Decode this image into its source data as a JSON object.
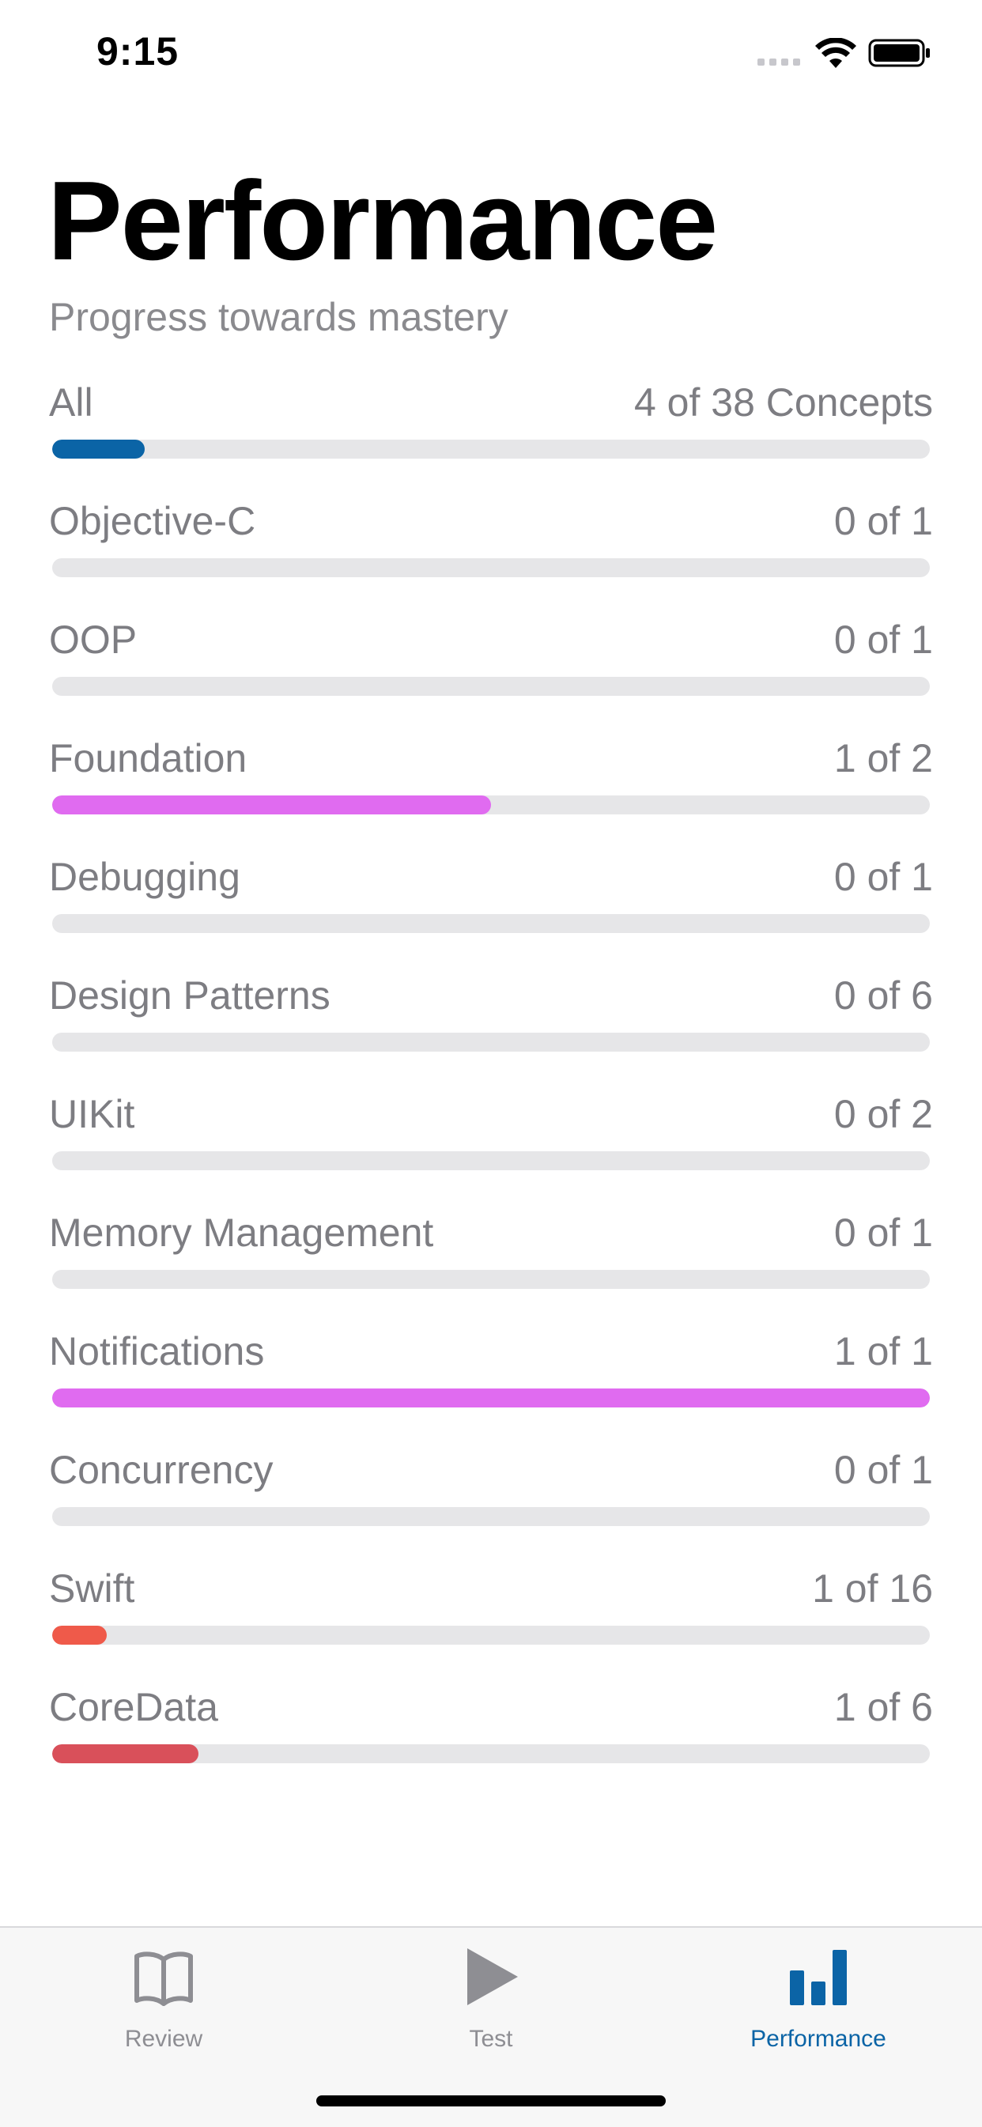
{
  "status_bar": {
    "time": "9:15"
  },
  "header": {
    "title": "Performance",
    "subtitle": "Progress towards mastery"
  },
  "colors": {
    "all": "#0b64a6",
    "pink": "#e06bf0",
    "red_light": "#ef5a4a",
    "red": "#d9505a",
    "track": "#e6e6e8",
    "active_tab": "#0b64a6",
    "inactive_tab": "#8e8e93"
  },
  "rows": [
    {
      "label": "All",
      "count": "4 of 38 Concepts",
      "progress": 0.105,
      "color": "#0b64a6"
    },
    {
      "label": "Objective-C",
      "count": "0 of 1",
      "progress": 0,
      "color": "#e06bf0"
    },
    {
      "label": "OOP",
      "count": "0 of 1",
      "progress": 0,
      "color": "#e06bf0"
    },
    {
      "label": "Foundation",
      "count": "1 of 2",
      "progress": 0.5,
      "color": "#e06bf0"
    },
    {
      "label": "Debugging",
      "count": "0 of 1",
      "progress": 0,
      "color": "#e06bf0"
    },
    {
      "label": "Design Patterns",
      "count": "0 of 6",
      "progress": 0,
      "color": "#e06bf0"
    },
    {
      "label": "UIKit",
      "count": "0 of 2",
      "progress": 0,
      "color": "#e06bf0"
    },
    {
      "label": "Memory Management",
      "count": "0 of 1",
      "progress": 0,
      "color": "#e06bf0"
    },
    {
      "label": "Notifications",
      "count": "1 of 1",
      "progress": 1,
      "color": "#e06bf0"
    },
    {
      "label": "Concurrency",
      "count": "0 of 1",
      "progress": 0,
      "color": "#e06bf0"
    },
    {
      "label": "Swift",
      "count": "1 of 16",
      "progress": 0.0625,
      "color": "#ef5a4a"
    },
    {
      "label": "CoreData",
      "count": "1 of 6",
      "progress": 0.1667,
      "color": "#d9505a"
    }
  ],
  "tabs": [
    {
      "label": "Review",
      "icon": "book-icon",
      "active": false
    },
    {
      "label": "Test",
      "icon": "play-icon",
      "active": false
    },
    {
      "label": "Performance",
      "icon": "bar-chart-icon",
      "active": true
    }
  ]
}
